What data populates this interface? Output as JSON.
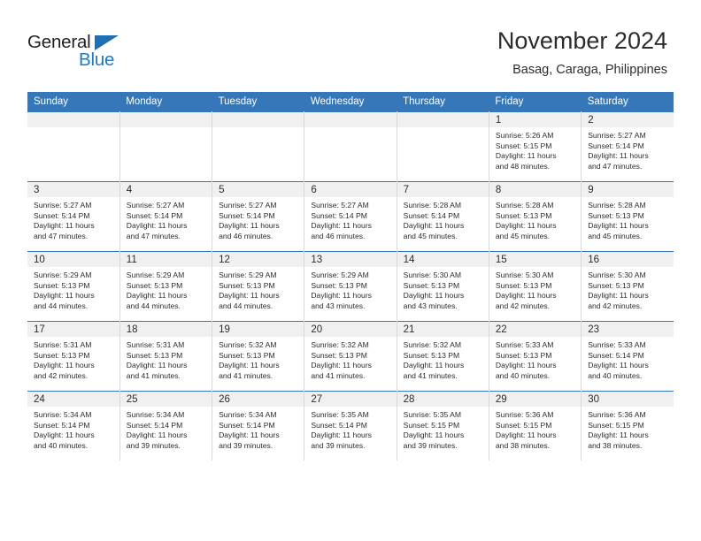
{
  "brand": {
    "name_part1": "General",
    "name_part2": "Blue",
    "accent_color": "#1d79c4",
    "header_color": "#3577b8"
  },
  "header": {
    "title": "November 2024",
    "subtitle": "Basag, Caraga, Philippines"
  },
  "weekday_headers": [
    "Sunday",
    "Monday",
    "Tuesday",
    "Wednesday",
    "Thursday",
    "Friday",
    "Saturday"
  ],
  "weeks": [
    [
      {
        "day": "",
        "empty": true
      },
      {
        "day": "",
        "empty": true
      },
      {
        "day": "",
        "empty": true
      },
      {
        "day": "",
        "empty": true
      },
      {
        "day": "",
        "empty": true
      },
      {
        "day": "1",
        "sunrise": "Sunrise: 5:26 AM",
        "sunset": "Sunset: 5:15 PM",
        "daylight1": "Daylight: 11 hours",
        "daylight2": "and 48 minutes."
      },
      {
        "day": "2",
        "sunrise": "Sunrise: 5:27 AM",
        "sunset": "Sunset: 5:14 PM",
        "daylight1": "Daylight: 11 hours",
        "daylight2": "and 47 minutes."
      }
    ],
    [
      {
        "day": "3",
        "sunrise": "Sunrise: 5:27 AM",
        "sunset": "Sunset: 5:14 PM",
        "daylight1": "Daylight: 11 hours",
        "daylight2": "and 47 minutes."
      },
      {
        "day": "4",
        "sunrise": "Sunrise: 5:27 AM",
        "sunset": "Sunset: 5:14 PM",
        "daylight1": "Daylight: 11 hours",
        "daylight2": "and 47 minutes."
      },
      {
        "day": "5",
        "sunrise": "Sunrise: 5:27 AM",
        "sunset": "Sunset: 5:14 PM",
        "daylight1": "Daylight: 11 hours",
        "daylight2": "and 46 minutes."
      },
      {
        "day": "6",
        "sunrise": "Sunrise: 5:27 AM",
        "sunset": "Sunset: 5:14 PM",
        "daylight1": "Daylight: 11 hours",
        "daylight2": "and 46 minutes."
      },
      {
        "day": "7",
        "sunrise": "Sunrise: 5:28 AM",
        "sunset": "Sunset: 5:14 PM",
        "daylight1": "Daylight: 11 hours",
        "daylight2": "and 45 minutes."
      },
      {
        "day": "8",
        "sunrise": "Sunrise: 5:28 AM",
        "sunset": "Sunset: 5:13 PM",
        "daylight1": "Daylight: 11 hours",
        "daylight2": "and 45 minutes."
      },
      {
        "day": "9",
        "sunrise": "Sunrise: 5:28 AM",
        "sunset": "Sunset: 5:13 PM",
        "daylight1": "Daylight: 11 hours",
        "daylight2": "and 45 minutes."
      }
    ],
    [
      {
        "day": "10",
        "sunrise": "Sunrise: 5:29 AM",
        "sunset": "Sunset: 5:13 PM",
        "daylight1": "Daylight: 11 hours",
        "daylight2": "and 44 minutes."
      },
      {
        "day": "11",
        "sunrise": "Sunrise: 5:29 AM",
        "sunset": "Sunset: 5:13 PM",
        "daylight1": "Daylight: 11 hours",
        "daylight2": "and 44 minutes."
      },
      {
        "day": "12",
        "sunrise": "Sunrise: 5:29 AM",
        "sunset": "Sunset: 5:13 PM",
        "daylight1": "Daylight: 11 hours",
        "daylight2": "and 44 minutes."
      },
      {
        "day": "13",
        "sunrise": "Sunrise: 5:29 AM",
        "sunset": "Sunset: 5:13 PM",
        "daylight1": "Daylight: 11 hours",
        "daylight2": "and 43 minutes."
      },
      {
        "day": "14",
        "sunrise": "Sunrise: 5:30 AM",
        "sunset": "Sunset: 5:13 PM",
        "daylight1": "Daylight: 11 hours",
        "daylight2": "and 43 minutes."
      },
      {
        "day": "15",
        "sunrise": "Sunrise: 5:30 AM",
        "sunset": "Sunset: 5:13 PM",
        "daylight1": "Daylight: 11 hours",
        "daylight2": "and 42 minutes."
      },
      {
        "day": "16",
        "sunrise": "Sunrise: 5:30 AM",
        "sunset": "Sunset: 5:13 PM",
        "daylight1": "Daylight: 11 hours",
        "daylight2": "and 42 minutes."
      }
    ],
    [
      {
        "day": "17",
        "sunrise": "Sunrise: 5:31 AM",
        "sunset": "Sunset: 5:13 PM",
        "daylight1": "Daylight: 11 hours",
        "daylight2": "and 42 minutes."
      },
      {
        "day": "18",
        "sunrise": "Sunrise: 5:31 AM",
        "sunset": "Sunset: 5:13 PM",
        "daylight1": "Daylight: 11 hours",
        "daylight2": "and 41 minutes."
      },
      {
        "day": "19",
        "sunrise": "Sunrise: 5:32 AM",
        "sunset": "Sunset: 5:13 PM",
        "daylight1": "Daylight: 11 hours",
        "daylight2": "and 41 minutes."
      },
      {
        "day": "20",
        "sunrise": "Sunrise: 5:32 AM",
        "sunset": "Sunset: 5:13 PM",
        "daylight1": "Daylight: 11 hours",
        "daylight2": "and 41 minutes."
      },
      {
        "day": "21",
        "sunrise": "Sunrise: 5:32 AM",
        "sunset": "Sunset: 5:13 PM",
        "daylight1": "Daylight: 11 hours",
        "daylight2": "and 41 minutes."
      },
      {
        "day": "22",
        "sunrise": "Sunrise: 5:33 AM",
        "sunset": "Sunset: 5:13 PM",
        "daylight1": "Daylight: 11 hours",
        "daylight2": "and 40 minutes."
      },
      {
        "day": "23",
        "sunrise": "Sunrise: 5:33 AM",
        "sunset": "Sunset: 5:14 PM",
        "daylight1": "Daylight: 11 hours",
        "daylight2": "and 40 minutes."
      }
    ],
    [
      {
        "day": "24",
        "sunrise": "Sunrise: 5:34 AM",
        "sunset": "Sunset: 5:14 PM",
        "daylight1": "Daylight: 11 hours",
        "daylight2": "and 40 minutes."
      },
      {
        "day": "25",
        "sunrise": "Sunrise: 5:34 AM",
        "sunset": "Sunset: 5:14 PM",
        "daylight1": "Daylight: 11 hours",
        "daylight2": "and 39 minutes."
      },
      {
        "day": "26",
        "sunrise": "Sunrise: 5:34 AM",
        "sunset": "Sunset: 5:14 PM",
        "daylight1": "Daylight: 11 hours",
        "daylight2": "and 39 minutes."
      },
      {
        "day": "27",
        "sunrise": "Sunrise: 5:35 AM",
        "sunset": "Sunset: 5:14 PM",
        "daylight1": "Daylight: 11 hours",
        "daylight2": "and 39 minutes."
      },
      {
        "day": "28",
        "sunrise": "Sunrise: 5:35 AM",
        "sunset": "Sunset: 5:15 PM",
        "daylight1": "Daylight: 11 hours",
        "daylight2": "and 39 minutes."
      },
      {
        "day": "29",
        "sunrise": "Sunrise: 5:36 AM",
        "sunset": "Sunset: 5:15 PM",
        "daylight1": "Daylight: 11 hours",
        "daylight2": "and 38 minutes."
      },
      {
        "day": "30",
        "sunrise": "Sunrise: 5:36 AM",
        "sunset": "Sunset: 5:15 PM",
        "daylight1": "Daylight: 11 hours",
        "daylight2": "and 38 minutes."
      }
    ]
  ]
}
